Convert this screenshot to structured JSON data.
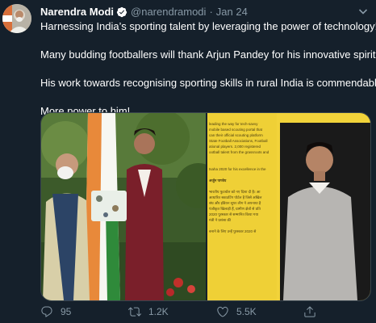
{
  "tweet": {
    "author_name": "Narendra Modi",
    "handle": "@narendramodi",
    "separator": "·",
    "date": "Jan 24",
    "lines": [
      "Harnessing India’s sporting talent by leveraging the power of technology!",
      "Many budding footballers will thank Arjun Pandey for his innovative spirit.",
      "His work towards recognising sporting skills in rural India is commendable.",
      "More power to him!"
    ]
  },
  "media": {
    "page_lines": [
      "leading the way for tech-savvy",
      "mobile based scouting portal that",
      "can their official scouting platform",
      "State Football Associations, Football",
      "ational players. 2,000 registered",
      "ootball talent from the grassroots and",
      "",
      "",
      "tsaha 2020 for his excellence in the",
      "",
      "अर्जुन पाण्डेय",
      "",
      "भारतीय फुटबॉल को नए दिशा दी है। आ",
      "आधारित स्काउटिंग पोर्टल है जिसे अखिल",
      "संघ और इंडियन सुपर लीग ने अपनाया है",
      "पंजीकृत खिलाड़ी हैं, ग्रामीण क्षेत्रों से प्रति",
      "2020 पुरस्कार से सम्मानित किया गया",
      "मंत्री ने प्रशंसा की",
      "",
      "बनाने के लिए उन्हें पुरस्कार 2020 से"
    ]
  },
  "actions": {
    "replies": "95",
    "retweets": "1.2K",
    "likes": "5.5K"
  },
  "colors": {
    "background": "#15202b",
    "secondary_text": "#8899a6",
    "verified": "#1da1f2",
    "card_yellow": "#f2d33a"
  },
  "icons": [
    "verified-badge-icon",
    "chevron-down-icon",
    "reply-icon",
    "retweet-icon",
    "like-icon",
    "share-icon"
  ]
}
